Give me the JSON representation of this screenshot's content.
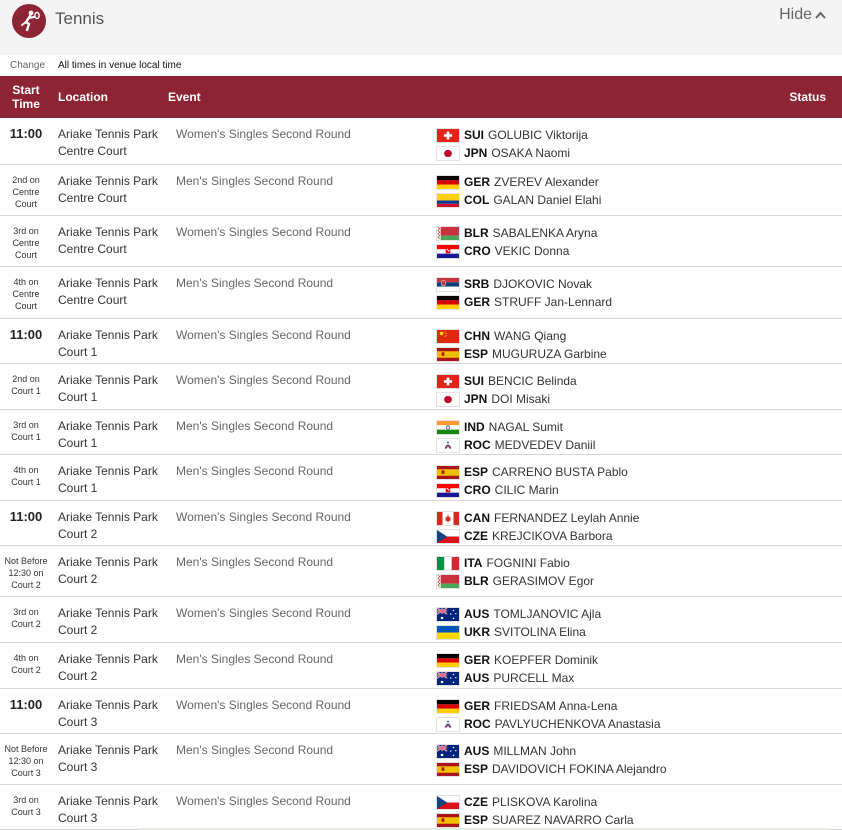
{
  "header": {
    "title": "Tennis",
    "hide_label": "Hide",
    "icon": "tennis-pictogram-icon",
    "brand_color": "#8d2434"
  },
  "subbar": {
    "change_label": "Change",
    "timezone_note": "All times in venue local time"
  },
  "table": {
    "columns": {
      "start_line1": "Start",
      "start_line2": "Time",
      "location": "Location",
      "event": "Event",
      "status": "Status"
    },
    "rows": [
      {
        "start": [
          "11:00"
        ],
        "big": true,
        "location": [
          "Ariake Tennis Park",
          "Centre Court"
        ],
        "event": "Women's Singles Second Round",
        "players": [
          {
            "flag": "SUI",
            "noc": "SUI",
            "name": "GOLUBIC Viktorija"
          },
          {
            "flag": "JPN",
            "noc": "JPN",
            "name": "OSAKA Naomi"
          }
        ]
      },
      {
        "start": [
          "2nd on",
          "Centre",
          "Court"
        ],
        "big": false,
        "location": [
          "Ariake Tennis Park",
          "Centre Court"
        ],
        "event": "Men's Singles Second Round",
        "players": [
          {
            "flag": "GER",
            "noc": "GER",
            "name": "ZVEREV Alexander"
          },
          {
            "flag": "COL",
            "noc": "COL",
            "name": "GALAN Daniel Elahi"
          }
        ]
      },
      {
        "start": [
          "3rd on",
          "Centre",
          "Court"
        ],
        "big": false,
        "location": [
          "Ariake Tennis Park",
          "Centre Court"
        ],
        "event": "Women's Singles Second Round",
        "players": [
          {
            "flag": "BLR",
            "noc": "BLR",
            "name": "SABALENKA Aryna"
          },
          {
            "flag": "CRO",
            "noc": "CRO",
            "name": "VEKIC Donna"
          }
        ]
      },
      {
        "start": [
          "4th on",
          "Centre",
          "Court"
        ],
        "big": false,
        "location": [
          "Ariake Tennis Park",
          "Centre Court"
        ],
        "event": "Men's Singles Second Round",
        "players": [
          {
            "flag": "SRB",
            "noc": "SRB",
            "name": "DJOKOVIC Novak"
          },
          {
            "flag": "GER",
            "noc": "GER",
            "name": "STRUFF Jan-Lennard"
          }
        ]
      },
      {
        "start": [
          "11:00"
        ],
        "big": true,
        "location": [
          "Ariake Tennis Park",
          "Court 1"
        ],
        "event": "Women's Singles Second Round",
        "players": [
          {
            "flag": "CHN",
            "noc": "CHN",
            "name": "WANG Qiang"
          },
          {
            "flag": "ESP",
            "noc": "ESP",
            "name": "MUGURUZA Garbine"
          }
        ]
      },
      {
        "start": [
          "2nd on",
          "Court 1"
        ],
        "big": false,
        "location": [
          "Ariake Tennis Park",
          "Court 1"
        ],
        "event": "Women's Singles Second Round",
        "players": [
          {
            "flag": "SUI",
            "noc": "SUI",
            "name": "BENCIC Belinda"
          },
          {
            "flag": "JPN",
            "noc": "JPN",
            "name": "DOI Misaki"
          }
        ]
      },
      {
        "start": [
          "3rd on",
          "Court 1"
        ],
        "big": false,
        "location": [
          "Ariake Tennis Park",
          "Court 1"
        ],
        "event": "Men's Singles Second Round",
        "players": [
          {
            "flag": "IND",
            "noc": "IND",
            "name": "NAGAL Sumit"
          },
          {
            "flag": "ROC",
            "noc": "ROC",
            "name": "MEDVEDEV Daniil"
          }
        ]
      },
      {
        "start": [
          "4th on",
          "Court 1"
        ],
        "big": false,
        "location": [
          "Ariake Tennis Park",
          "Court 1"
        ],
        "event": "Men's Singles Second Round",
        "players": [
          {
            "flag": "ESP",
            "noc": "ESP",
            "name": "CARRENO BUSTA Pablo"
          },
          {
            "flag": "CRO",
            "noc": "CRO",
            "name": "CILIC Marin"
          }
        ]
      },
      {
        "start": [
          "11:00"
        ],
        "big": true,
        "location": [
          "Ariake Tennis Park",
          "Court 2"
        ],
        "event": "Women's Singles Second Round",
        "players": [
          {
            "flag": "CAN",
            "noc": "CAN",
            "name": "FERNANDEZ Leylah Annie"
          },
          {
            "flag": "CZE",
            "noc": "CZE",
            "name": "KREJCIKOVA Barbora"
          }
        ]
      },
      {
        "start": [
          "Not Before",
          "12:30 on",
          "Court 2"
        ],
        "big": false,
        "location": [
          "Ariake Tennis Park",
          "Court 2"
        ],
        "event": "Men's Singles Second Round",
        "players": [
          {
            "flag": "ITA",
            "noc": "ITA",
            "name": "FOGNINI Fabio"
          },
          {
            "flag": "BLR",
            "noc": "BLR",
            "name": "GERASIMOV Egor"
          }
        ]
      },
      {
        "start": [
          "3rd on",
          "Court 2"
        ],
        "big": false,
        "location": [
          "Ariake Tennis Park",
          "Court 2"
        ],
        "event": "Women's Singles Second Round",
        "players": [
          {
            "flag": "AUS",
            "noc": "AUS",
            "name": "TOMLJANOVIC Ajla"
          },
          {
            "flag": "UKR",
            "noc": "UKR",
            "name": "SVITOLINA Elina"
          }
        ]
      },
      {
        "start": [
          "4th on",
          "Court 2"
        ],
        "big": false,
        "location": [
          "Ariake Tennis Park",
          "Court 2"
        ],
        "event": "Men's Singles Second Round",
        "players": [
          {
            "flag": "GER",
            "noc": "GER",
            "name": "KOEPFER Dominik"
          },
          {
            "flag": "AUS",
            "noc": "AUS",
            "name": "PURCELL Max"
          }
        ]
      },
      {
        "start": [
          "11:00"
        ],
        "big": true,
        "location": [
          "Ariake Tennis Park",
          "Court 3"
        ],
        "event": "Women's Singles Second Round",
        "players": [
          {
            "flag": "GER",
            "noc": "GER",
            "name": "FRIEDSAM Anna-Lena"
          },
          {
            "flag": "ROC",
            "noc": "ROC",
            "name": "PAVLYUCHENKOVA Anastasia"
          }
        ]
      },
      {
        "start": [
          "Not Before",
          "12:30 on",
          "Court 3"
        ],
        "big": false,
        "location": [
          "Ariake Tennis Park",
          "Court 3"
        ],
        "event": "Men's Singles Second Round",
        "players": [
          {
            "flag": "AUS",
            "noc": "AUS",
            "name": "MILLMAN John"
          },
          {
            "flag": "ESP",
            "noc": "ESP",
            "name": "DAVIDOVICH FOKINA Alejandro"
          }
        ]
      },
      {
        "start": [
          "3rd on",
          "Court 3"
        ],
        "big": false,
        "location": [
          "Ariake Tennis Park",
          "Court 3"
        ],
        "event": "Women's Singles Second Round",
        "players": [
          {
            "flag": "CZE",
            "noc": "CZE",
            "name": "PLISKOVA Karolina"
          },
          {
            "flag": "ESP",
            "noc": "ESP",
            "name": "SUAREZ NAVARRO Carla"
          }
        ]
      }
    ]
  }
}
